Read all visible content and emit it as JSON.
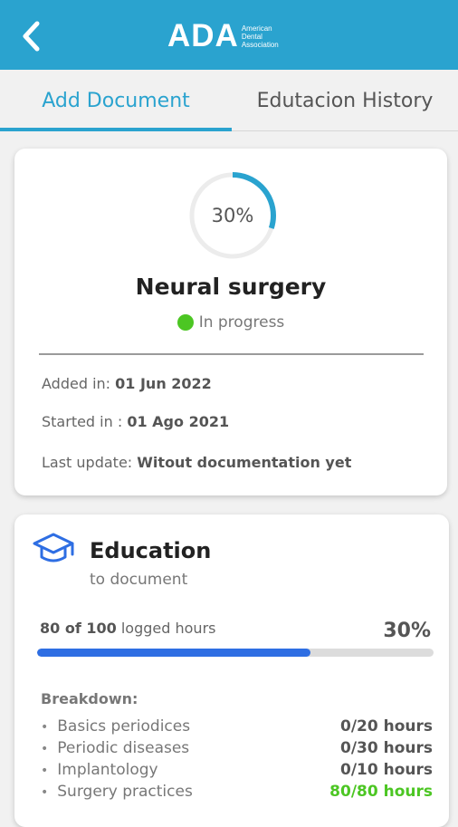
{
  "header": {
    "logo_text": "ADA",
    "logo_sub": [
      "American",
      "Dental",
      "Association"
    ]
  },
  "tabs": [
    {
      "label": "Add Document",
      "active": true
    },
    {
      "label": "Edutacion History",
      "active": false
    }
  ],
  "course": {
    "progress_percent": 30,
    "progress_label": "30%",
    "title": "Neural surgery",
    "status": "In progress",
    "added_label": "Added in:",
    "added_value": "01 Jun 2022",
    "started_label": "Started in :",
    "started_value": "01 Ago 2021",
    "update_label": "Last update:",
    "update_value": "Witout documentation yet"
  },
  "education": {
    "title": "Education",
    "subtitle": "to document",
    "hours_logged": "80 of 100",
    "hours_text": "logged hours",
    "percent_label": "30%",
    "bar_fill_percent": 69,
    "breakdown_title": "Breakdown:",
    "breakdown": [
      {
        "name": "Basics periodices",
        "hours": "0/20 hours",
        "complete": false
      },
      {
        "name": "Periodic diseases",
        "hours": "0/30 hours",
        "complete": false
      },
      {
        "name": "Implantology",
        "hours": "0/10 hours",
        "complete": false
      },
      {
        "name": "Surgery practices",
        "hours": "80/80 hours",
        "complete": true
      }
    ]
  },
  "colors": {
    "primary": "#2aa3cf",
    "bar": "#2e6ee3",
    "status_ok": "#4cc623"
  },
  "icons": [
    "back-arrow-icon",
    "graduation-cap-icon"
  ]
}
